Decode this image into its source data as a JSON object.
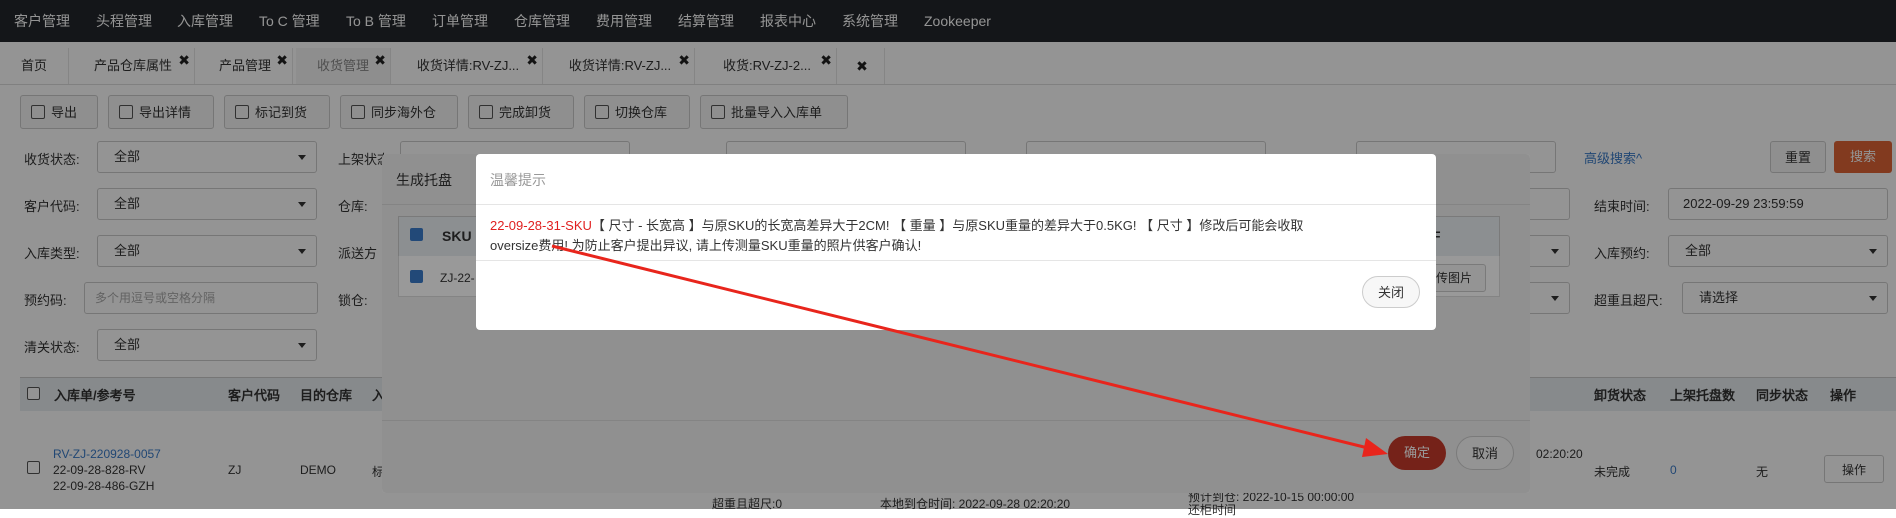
{
  "nav": {
    "items": [
      "客户管理",
      "头程管理",
      "入库管理",
      "To C 管理",
      "To B 管理",
      "订单管理",
      "仓库管理",
      "费用管理",
      "结算管理",
      "报表中心",
      "系统管理",
      "Zookeeper"
    ]
  },
  "tabs": [
    {
      "label": "首页"
    },
    {
      "label": "产品仓库属性"
    },
    {
      "label": "产品管理"
    },
    {
      "label": "收货管理"
    },
    {
      "label": "收货详情:RV-ZJ..."
    },
    {
      "label": "收货详情:RV-ZJ..."
    },
    {
      "label": "收货:RV-ZJ-2..."
    }
  ],
  "tab_close_symbol": "✖",
  "toolbar": [
    "导出",
    "导出详情",
    "标记到货",
    "同步海外仓",
    "完成卸货",
    "切换仓库",
    "批量导入入库单"
  ],
  "filters": {
    "receive_status_label": "收货状态:",
    "receive_status_value": "全部",
    "shelf_status_label": "上架状态",
    "customer_code_label": "客户代码:",
    "customer_code_value": "全部",
    "warehouse_label": "仓库:",
    "inbound_type_label": "入库类型:",
    "inbound_type_value": "全部",
    "dispatch_label": "派送方",
    "reserve_code_label": "预约码:",
    "reserve_code_placeholder": "多个用逗号或空格分隔",
    "lock_label": "锁仓:",
    "customs_status_label": "清关状态:",
    "customs_status_value": "全部",
    "advanced_search": "高级搜索^",
    "reset": "重置",
    "search": "搜索",
    "end_time_label": "结束时间:",
    "end_time_value": "2022-09-29 23:59:59",
    "inbound_reserve_label": "入库预约:",
    "inbound_reserve_value": "全部",
    "overweight_label": "超重且超尺:",
    "overweight_value": "请选择"
  },
  "table": {
    "headers": [
      "入库单/参考号",
      "客户代码",
      "目的仓库",
      "入",
      "卸货状态",
      "上架托盘数",
      "同步状态",
      "操作"
    ],
    "row": {
      "link": "RV-ZJ-220928-0057",
      "ref1": "22-09-28-828-RV",
      "ref2": "22-09-28-486-GZH",
      "customer": "ZJ",
      "warehouse": "DEMO",
      "type": "标",
      "time1": "02:20:20",
      "unload": "未完成",
      "pallets": "0",
      "sync": "无",
      "action": "操作",
      "overweight_note": "超重且超尺:0",
      "local_time": "本地到仓时间: 2022-09-28 02:20:20",
      "expected": "预计到仓: 2022-10-15 00:00:00",
      "extra": "还柜时间"
    }
  },
  "dialog1": {
    "title": "生成托盘",
    "col_sku": "SKU",
    "col_last": "F",
    "row_sku": "ZJ-22-",
    "upload_btn": "传图片",
    "confirm": "确定",
    "cancel": "取消"
  },
  "dialog2": {
    "title": "温馨提示",
    "sku_red": "22-09-28-31-SKU",
    "message_line1": "【 尺寸 - 长宽高 】与原SKU的长宽高差异大于2CM! 【 重量 】与原SKU重量的差异大于0.5KG! 【 尺寸 】修改后可能会收取",
    "message_line2": "oversize费用! 为防止客户提出异议, 请上传测量SKU重量的照片供客户确认!",
    "close": "关闭"
  },
  "colors": {
    "nav_bg": "#23272b",
    "search_btn": "#e06436",
    "link": "#3a7bc8",
    "confirm_btn": "#c33a2b",
    "arrow": "#e8251c",
    "sku_red": "#e02020"
  }
}
